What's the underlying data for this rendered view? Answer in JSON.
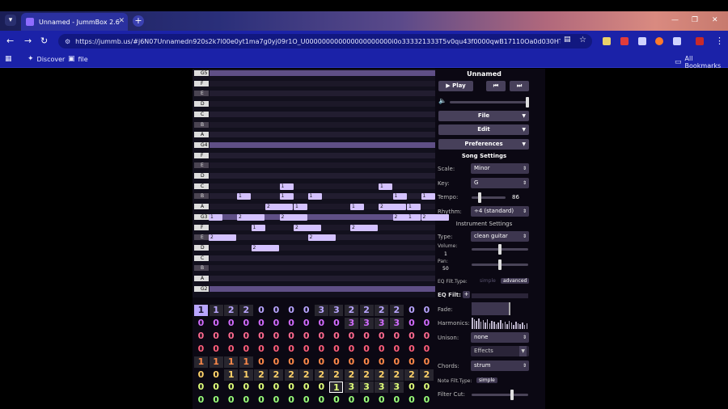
{
  "browser": {
    "tab_title": "Unnamed - JummBox 2.6",
    "url": "https://jummb.us/#j6N07Unnamedn920s2k7l00e0yt1ma7g0yj09r1O_U000000000000000000000i0o333321333T5v0qu43f0000qwB17110Oa0d030HT_QT_ItRAJJAAz...",
    "bookmarks": [
      "Discover",
      "file"
    ],
    "all_bookmarks": "All Bookmarks"
  },
  "colors": {
    "tab_active": "#2b31a0",
    "toolbar": "#1b22a8",
    "note": "#d4c2ff",
    "bg": "#0b0813"
  },
  "piano_keys": [
    "G5",
    "F",
    "E",
    "D",
    "C",
    "B",
    "A",
    "G4",
    "F",
    "E",
    "D",
    "C",
    "B",
    "A",
    "G3",
    "F",
    "E",
    "D",
    "C",
    "B",
    "A",
    "G2"
  ],
  "notes": [
    {
      "label": "1",
      "row": "C",
      "col": 6
    },
    {
      "label": "1",
      "row": "C",
      "col": 13
    },
    {
      "label": "1",
      "row": "B",
      "col": 3
    },
    {
      "label": "1",
      "row": "B",
      "col": 6
    },
    {
      "label": "1",
      "row": "B",
      "col": 8
    },
    {
      "label": "1",
      "row": "B",
      "col": 14
    },
    {
      "label": "1",
      "row": "B",
      "col": 16
    },
    {
      "label": "2",
      "row": "A",
      "col": 5
    },
    {
      "label": "1",
      "row": "A",
      "col": 7
    },
    {
      "label": "1",
      "row": "A",
      "col": 11
    },
    {
      "label": "2",
      "row": "A",
      "col": 13
    },
    {
      "label": "1",
      "row": "A",
      "col": 15
    },
    {
      "label": "1",
      "row": "G3",
      "col": 1
    },
    {
      "label": "2",
      "row": "G3",
      "col": 3
    },
    {
      "label": "2",
      "row": "G3",
      "col": 6
    },
    {
      "label": "2",
      "row": "G3",
      "col": 14
    },
    {
      "label": "1",
      "row": "G3",
      "col": 15
    },
    {
      "label": "2",
      "row": "G3",
      "col": 16
    },
    {
      "label": "1",
      "row": "F",
      "col": 4
    },
    {
      "label": "2",
      "row": "F",
      "col": 7
    },
    {
      "label": "2",
      "row": "F",
      "col": 11
    },
    {
      "label": "2",
      "row": "E",
      "col": 1
    },
    {
      "label": "2",
      "row": "E",
      "col": 8
    },
    {
      "label": "2",
      "row": "D",
      "col": 4
    }
  ],
  "pattern_rows": [
    {
      "color": "#b9a5ff",
      "values": [
        "1",
        "1",
        "2",
        "2",
        "0",
        "0",
        "0",
        "0",
        "3",
        "3",
        "2",
        "2",
        "2",
        "2",
        "0",
        "0"
      ]
    },
    {
      "color": "#d36cff",
      "values": [
        "0",
        "0",
        "0",
        "0",
        "0",
        "0",
        "0",
        "0",
        "0",
        "0",
        "3",
        "3",
        "3",
        "3",
        "0",
        "0"
      ]
    },
    {
      "color": "#ff6a8f",
      "values": [
        "0",
        "0",
        "0",
        "0",
        "0",
        "0",
        "0",
        "0",
        "0",
        "0",
        "0",
        "0",
        "0",
        "0",
        "0",
        "0"
      ]
    },
    {
      "color": "#ff5e7a",
      "values": [
        "0",
        "0",
        "0",
        "0",
        "0",
        "0",
        "0",
        "0",
        "0",
        "0",
        "0",
        "0",
        "0",
        "0",
        "0",
        "0"
      ]
    },
    {
      "color": "#ff8a4a",
      "values": [
        "1",
        "1",
        "1",
        "1",
        "0",
        "0",
        "0",
        "0",
        "0",
        "0",
        "0",
        "0",
        "0",
        "0",
        "0",
        "0"
      ]
    },
    {
      "color": "#ffd36a",
      "values": [
        "0",
        "0",
        "1",
        "1",
        "2",
        "2",
        "2",
        "2",
        "2",
        "2",
        "2",
        "2",
        "2",
        "2",
        "2",
        "2"
      ]
    },
    {
      "color": "#e0ff7a",
      "values": [
        "0",
        "0",
        "0",
        "0",
        "0",
        "0",
        "0",
        "0",
        "0",
        "1",
        "3",
        "3",
        "3",
        "3",
        "0",
        "0"
      ]
    },
    {
      "color": "#9aff7a",
      "values": [
        "0",
        "0",
        "0",
        "0",
        "0",
        "0",
        "0",
        "0",
        "0",
        "0",
        "0",
        "0",
        "0",
        "0",
        "0",
        "0"
      ]
    }
  ],
  "panel": {
    "song_title": "Unnamed",
    "play": "Play",
    "file": "File",
    "edit": "Edit",
    "preferences": "Preferences",
    "song_settings": "Song Settings",
    "scale_label": "Scale:",
    "scale": "Minor",
    "key_label": "Key:",
    "key": "G",
    "tempo_label": "Tempo:",
    "tempo": "86",
    "rhythm_label": "Rhythm:",
    "rhythm": "÷4 (standard)",
    "instrument_settings": "Instrument Settings",
    "type_label": "Type:",
    "type": "clean guitar",
    "volume_label": "Volume:",
    "volume": "1",
    "pan_label": "Pan:",
    "pan": "50",
    "eq_type_label": "EQ Filt.Type:",
    "eq_simple": "simple",
    "eq_advanced": "advanced",
    "eq_label": "EQ Filt:",
    "fade_label": "Fade:",
    "harmonics_label": "Harmonics:",
    "unison_label": "Unison:",
    "unison": "none",
    "effects": "Effects",
    "chords_label": "Chords:",
    "chords": "strum",
    "note_filt_label": "Note Filt.Type:",
    "note_simple": "simple",
    "filter_cut_label": "Filter Cut:"
  }
}
